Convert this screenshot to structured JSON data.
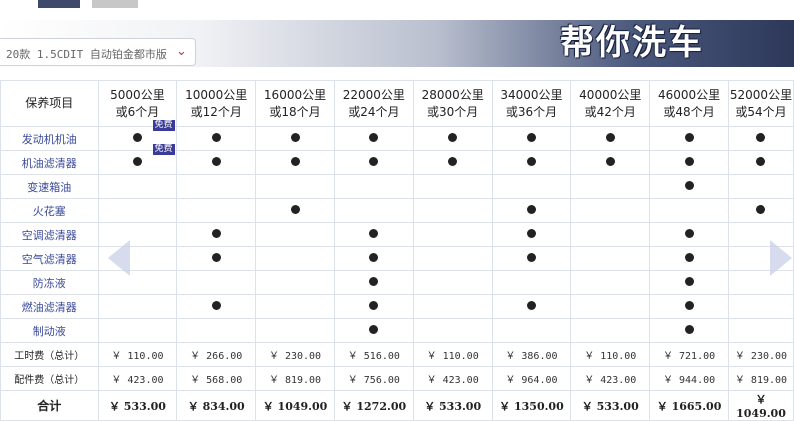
{
  "brand": {
    "text": "帮你洗车"
  },
  "model_select": {
    "value": "20款 1.5CDIT 自动铂金都市版"
  },
  "table": {
    "corner_label": "保养项目",
    "intervals": [
      {
        "km": "5000公里",
        "months": "或6个月"
      },
      {
        "km": "10000公里",
        "months": "或12个月"
      },
      {
        "km": "16000公里",
        "months": "或18个月"
      },
      {
        "km": "22000公里",
        "months": "或24个月"
      },
      {
        "km": "28000公里",
        "months": "或30个月"
      },
      {
        "km": "34000公里",
        "months": "或36个月"
      },
      {
        "km": "40000公里",
        "months": "或42个月"
      },
      {
        "km": "46000公里",
        "months": "或48个月"
      },
      {
        "km": "52000公里",
        "months": "或54个月"
      }
    ],
    "items": [
      {
        "name": "发动机机油",
        "marks": [
          1,
          1,
          1,
          1,
          1,
          1,
          1,
          1,
          1
        ],
        "free": [
          1,
          0,
          0,
          0,
          0,
          0,
          0,
          0,
          0
        ]
      },
      {
        "name": "机油滤清器",
        "marks": [
          1,
          1,
          1,
          1,
          1,
          1,
          1,
          1,
          1
        ],
        "free": [
          1,
          0,
          0,
          0,
          0,
          0,
          0,
          0,
          0
        ]
      },
      {
        "name": "变速箱油",
        "marks": [
          0,
          0,
          0,
          0,
          0,
          0,
          0,
          1,
          0
        ],
        "free": [
          0,
          0,
          0,
          0,
          0,
          0,
          0,
          0,
          0
        ]
      },
      {
        "name": "火花塞",
        "marks": [
          0,
          0,
          1,
          0,
          0,
          1,
          0,
          0,
          1
        ],
        "free": [
          0,
          0,
          0,
          0,
          0,
          0,
          0,
          0,
          0
        ]
      },
      {
        "name": "空调滤清器",
        "marks": [
          0,
          1,
          0,
          1,
          0,
          1,
          0,
          1,
          0
        ],
        "free": [
          0,
          0,
          0,
          0,
          0,
          0,
          0,
          0,
          0
        ]
      },
      {
        "name": "空气滤清器",
        "marks": [
          0,
          1,
          0,
          1,
          0,
          1,
          0,
          1,
          0
        ],
        "free": [
          0,
          0,
          0,
          0,
          0,
          0,
          0,
          0,
          0
        ]
      },
      {
        "name": "防冻液",
        "marks": [
          0,
          0,
          0,
          1,
          0,
          0,
          0,
          1,
          0
        ],
        "free": [
          0,
          0,
          0,
          0,
          0,
          0,
          0,
          0,
          0
        ]
      },
      {
        "name": "燃油滤清器",
        "marks": [
          0,
          1,
          0,
          1,
          0,
          1,
          0,
          1,
          0
        ],
        "free": [
          0,
          0,
          0,
          0,
          0,
          0,
          0,
          0,
          0
        ]
      },
      {
        "name": "制动液",
        "marks": [
          0,
          0,
          0,
          1,
          0,
          0,
          0,
          1,
          0
        ],
        "free": [
          0,
          0,
          0,
          0,
          0,
          0,
          0,
          0,
          0
        ]
      }
    ],
    "free_label": "免费",
    "labor_label": "工时费（总计）",
    "labor": [
      "￥ 110.00",
      "￥ 266.00",
      "￥ 230.00",
      "￥ 516.00",
      "￥ 110.00",
      "￥ 386.00",
      "￥ 110.00",
      "￥ 721.00",
      "￥ 230.00"
    ],
    "parts_label": "配件费（总计）",
    "parts": [
      "￥ 423.00",
      "￥ 568.00",
      "￥ 819.00",
      "￥ 756.00",
      "￥ 423.00",
      "￥ 964.00",
      "￥ 423.00",
      "￥ 944.00",
      "￥ 819.00"
    ],
    "total_label": "合计",
    "totals": [
      "￥ 533.00",
      "￥ 834.00",
      "￥ 1049.00",
      "￥ 1272.00",
      "￥ 533.00",
      "￥ 1350.00",
      "￥ 533.00",
      "￥ 1665.00",
      "￥ 1049.00"
    ]
  }
}
